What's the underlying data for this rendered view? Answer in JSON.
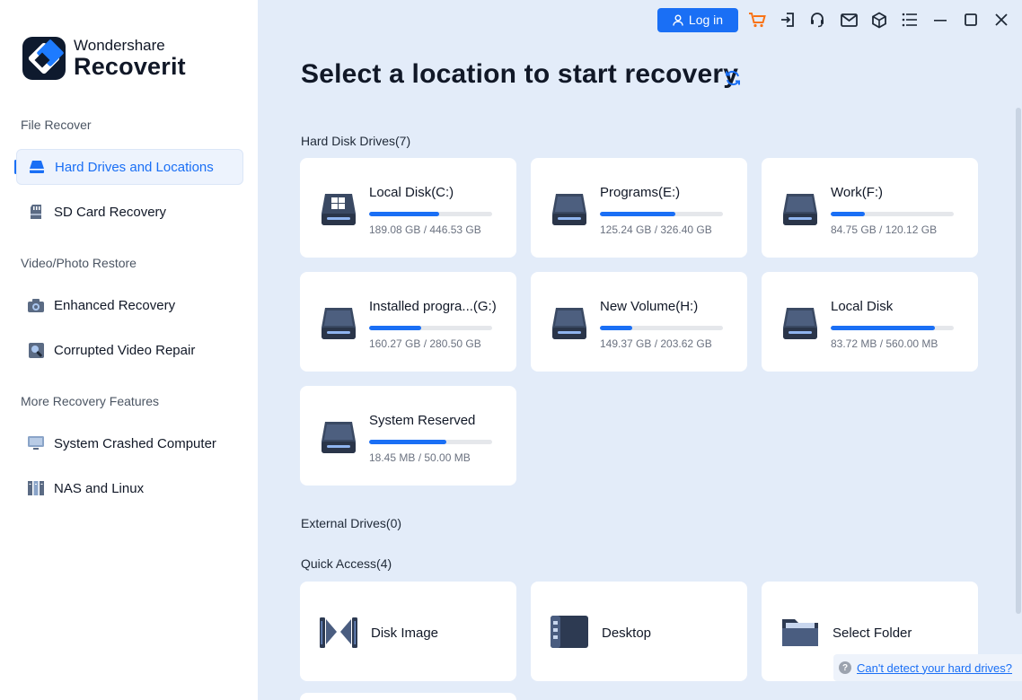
{
  "app": {
    "brand": "Wondershare",
    "product": "Recoverit"
  },
  "topbar": {
    "login_label": "Log in",
    "icons": [
      "cart-icon",
      "sign-in-icon",
      "support-icon",
      "mail-icon",
      "box-icon",
      "menu-icon",
      "minimize-icon",
      "maximize-icon",
      "close-icon"
    ]
  },
  "sidebar": {
    "sections": [
      {
        "label": "File Recover",
        "items": [
          {
            "label": "Hard Drives and Locations",
            "icon": "hard-drive-icon",
            "active": true
          },
          {
            "label": "SD Card Recovery",
            "icon": "sd-card-icon",
            "active": false
          }
        ]
      },
      {
        "label": "Video/Photo Restore",
        "items": [
          {
            "label": "Enhanced Recovery",
            "icon": "camera-icon",
            "active": false
          },
          {
            "label": "Corrupted Video Repair",
            "icon": "video-repair-icon",
            "active": false
          }
        ]
      },
      {
        "label": "More Recovery Features",
        "items": [
          {
            "label": "System Crashed Computer",
            "icon": "monitor-icon",
            "active": false
          },
          {
            "label": "NAS and Linux",
            "icon": "nas-icon",
            "active": false
          }
        ]
      }
    ]
  },
  "main": {
    "title": "Select a location to start recovery",
    "hard_disk_label": "Hard Disk Drives(7)",
    "drives": [
      {
        "name": "Local Disk(C:)",
        "size": "189.08 GB / 446.53 GB",
        "fill": 0.57,
        "icon": "windows-disk-icon"
      },
      {
        "name": "Programs(E:)",
        "size": "125.24 GB / 326.40 GB",
        "fill": 0.61,
        "icon": "disk-icon"
      },
      {
        "name": "Work(F:)",
        "size": "84.75 GB / 120.12 GB",
        "fill": 0.28,
        "icon": "disk-icon"
      },
      {
        "name": "Installed progra...(G:)",
        "size": "160.27 GB / 280.50 GB",
        "fill": 0.42,
        "icon": "disk-icon"
      },
      {
        "name": "New Volume(H:)",
        "size": "149.37 GB / 203.62 GB",
        "fill": 0.26,
        "icon": "disk-icon"
      },
      {
        "name": "Local Disk",
        "size": "83.72 MB / 560.00 MB",
        "fill": 0.85,
        "icon": "disk-icon"
      },
      {
        "name": "System Reserved",
        "size": "18.45 MB / 50.00 MB",
        "fill": 0.63,
        "icon": "disk-icon"
      }
    ],
    "external_label": "External Drives(0)",
    "quick_access_label": "Quick Access(4)",
    "quick_access": [
      {
        "label": "Disk Image",
        "icon": "disk-image-icon"
      },
      {
        "label": "Desktop",
        "icon": "desktop-icon"
      },
      {
        "label": "Select Folder",
        "icon": "folder-icon"
      }
    ],
    "help_link": "Can't detect your hard drives?",
    "accent": "#1a6ff5"
  }
}
